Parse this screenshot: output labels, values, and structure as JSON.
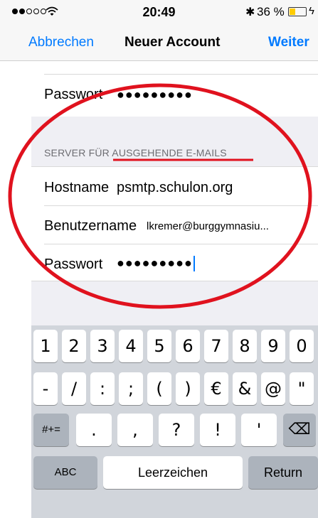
{
  "statusbar": {
    "time": "20:49",
    "battery_percent_text": "36 %",
    "battery_level": 0.36,
    "bluetooth_glyph": "✱",
    "charging_glyph": "ϟ"
  },
  "navbar": {
    "cancel_label": "Abbrechen",
    "title": "Neuer Account",
    "next_label": "Weiter"
  },
  "incoming": {
    "password_label": "Passwort",
    "password_value": "●●●●●●●●●"
  },
  "outgoing": {
    "section_title": "SERVER FÜR AUSGEHENDE E-MAILS",
    "hostname_label": "Hostname",
    "hostname_value": "psmtp.schulon.org",
    "username_label": "Benutzername",
    "username_value": "lkremer@burggymnasiu...",
    "password_label": "Passwort",
    "password_value": "●●●●●●●●●"
  },
  "keyboard": {
    "row1": [
      "1",
      "2",
      "3",
      "4",
      "5",
      "6",
      "7",
      "8",
      "9",
      "0"
    ],
    "row2": [
      "-",
      "/",
      ":",
      ";",
      "(",
      ")",
      "€",
      "&",
      "@",
      "\""
    ],
    "row3_mode": "#+=",
    "row3": [
      ".",
      ",",
      "?",
      "!",
      "'"
    ],
    "delete_icon": "⌫",
    "abc": "ABC",
    "space": "Leerzeichen",
    "return": "Return"
  },
  "colors": {
    "accent": "#007aff",
    "annotation": "#e0121e",
    "battery": "#ffcc00"
  }
}
